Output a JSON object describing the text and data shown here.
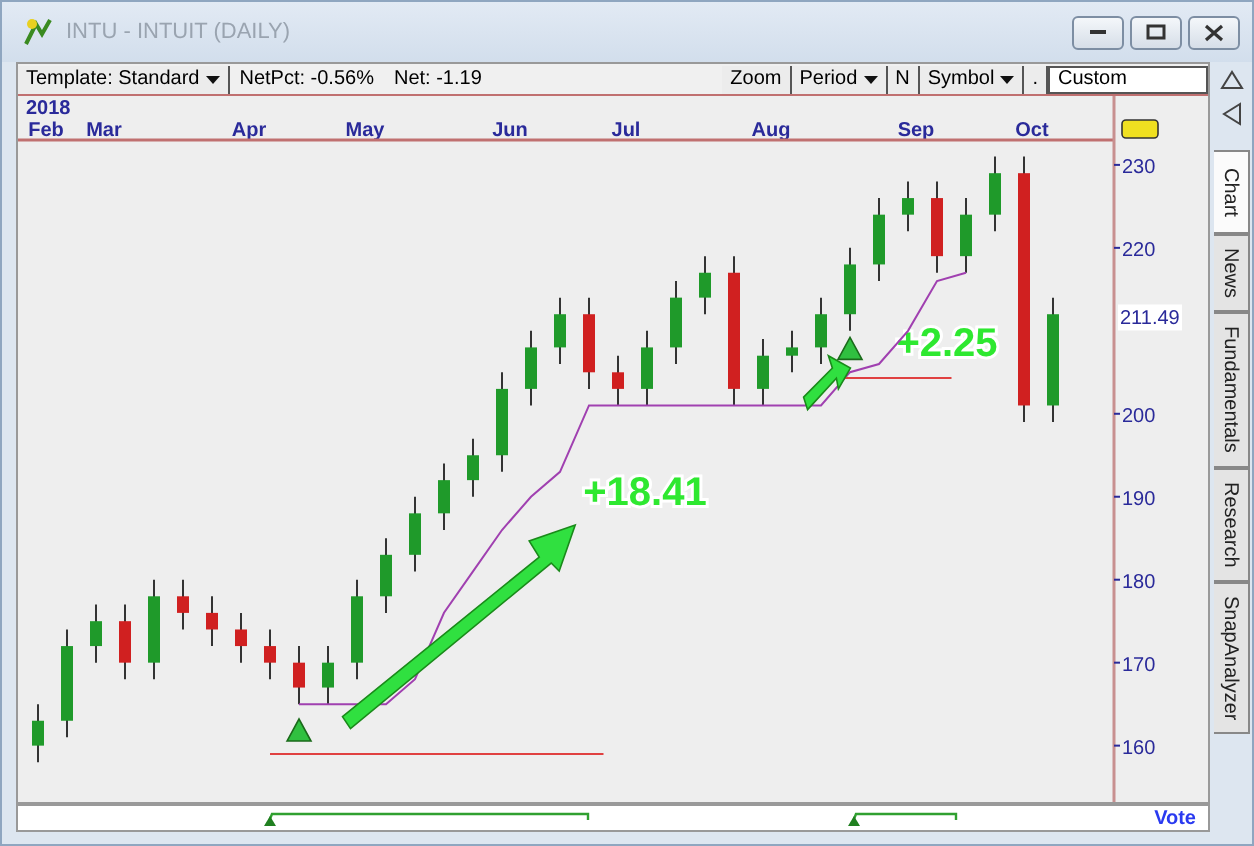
{
  "window": {
    "title": "INTU - INTUIT (DAILY)"
  },
  "toolbar": {
    "template": "Template: Standard",
    "net_pct": "NetPct: -0.56%",
    "net": "Net: -1.19",
    "zoom": "Zoom",
    "period": "Period",
    "n": "N",
    "symbol": "Symbol",
    "dot": ".",
    "custom": "Custom"
  },
  "date_axis": {
    "year": "2018"
  },
  "chart": {
    "last_price": "211.49",
    "chart_data": {
      "type": "candlestick",
      "categories": [
        "Feb",
        null,
        "Mar",
        null,
        null,
        null,
        null,
        "Apr",
        null,
        null,
        null,
        "May",
        null,
        null,
        null,
        null,
        "Jun",
        null,
        null,
        null,
        "Jul",
        null,
        null,
        null,
        null,
        "Aug",
        null,
        null,
        null,
        null,
        "Sep",
        null,
        null,
        null,
        "Oct",
        null
      ],
      "ohlc": [
        [
          160,
          165,
          158,
          163
        ],
        [
          163,
          174,
          161,
          172
        ],
        [
          172,
          177,
          170,
          175
        ],
        [
          175,
          177,
          168,
          170
        ],
        [
          170,
          180,
          168,
          178
        ],
        [
          178,
          180,
          174,
          176
        ],
        [
          176,
          178,
          172,
          174
        ],
        [
          174,
          176,
          170,
          172
        ],
        [
          172,
          174,
          168,
          170
        ],
        [
          170,
          172,
          165,
          167
        ],
        [
          167,
          172,
          165,
          170
        ],
        [
          170,
          180,
          168,
          178
        ],
        [
          178,
          185,
          176,
          183
        ],
        [
          183,
          190,
          181,
          188
        ],
        [
          188,
          194,
          186,
          192
        ],
        [
          192,
          197,
          190,
          195
        ],
        [
          195,
          205,
          193,
          203
        ],
        [
          203,
          210,
          201,
          208
        ],
        [
          208,
          214,
          206,
          212
        ],
        [
          212,
          214,
          203,
          205
        ],
        [
          205,
          207,
          201,
          203
        ],
        [
          203,
          210,
          201,
          208
        ],
        [
          208,
          216,
          206,
          214
        ],
        [
          214,
          219,
          212,
          217
        ],
        [
          217,
          219,
          201,
          203
        ],
        [
          203,
          209,
          201,
          207
        ],
        [
          207,
          210,
          205,
          208
        ],
        [
          208,
          214,
          206,
          212
        ],
        [
          212,
          220,
          210,
          218
        ],
        [
          218,
          226,
          216,
          224
        ],
        [
          224,
          228,
          222,
          226
        ],
        [
          226,
          228,
          217,
          219
        ],
        [
          219,
          226,
          217,
          224
        ],
        [
          224,
          231,
          222,
          229
        ],
        [
          229,
          231,
          199,
          201
        ],
        [
          201,
          214,
          199,
          212
        ]
      ],
      "ylim": [
        152,
        233
      ],
      "yticks": [
        160,
        170,
        180,
        190,
        200,
        220,
        230
      ],
      "annotations": [
        "+18.41",
        "+2.25"
      ]
    }
  },
  "side_tabs": [
    {
      "label": "Chart",
      "selected": true
    },
    {
      "label": "News",
      "selected": false
    },
    {
      "label": "Fundamentals",
      "selected": false
    },
    {
      "label": "Research",
      "selected": false
    },
    {
      "label": "SnapAnalyzer",
      "selected": false
    }
  ],
  "bottom_bar": {
    "vote": "Vote"
  }
}
